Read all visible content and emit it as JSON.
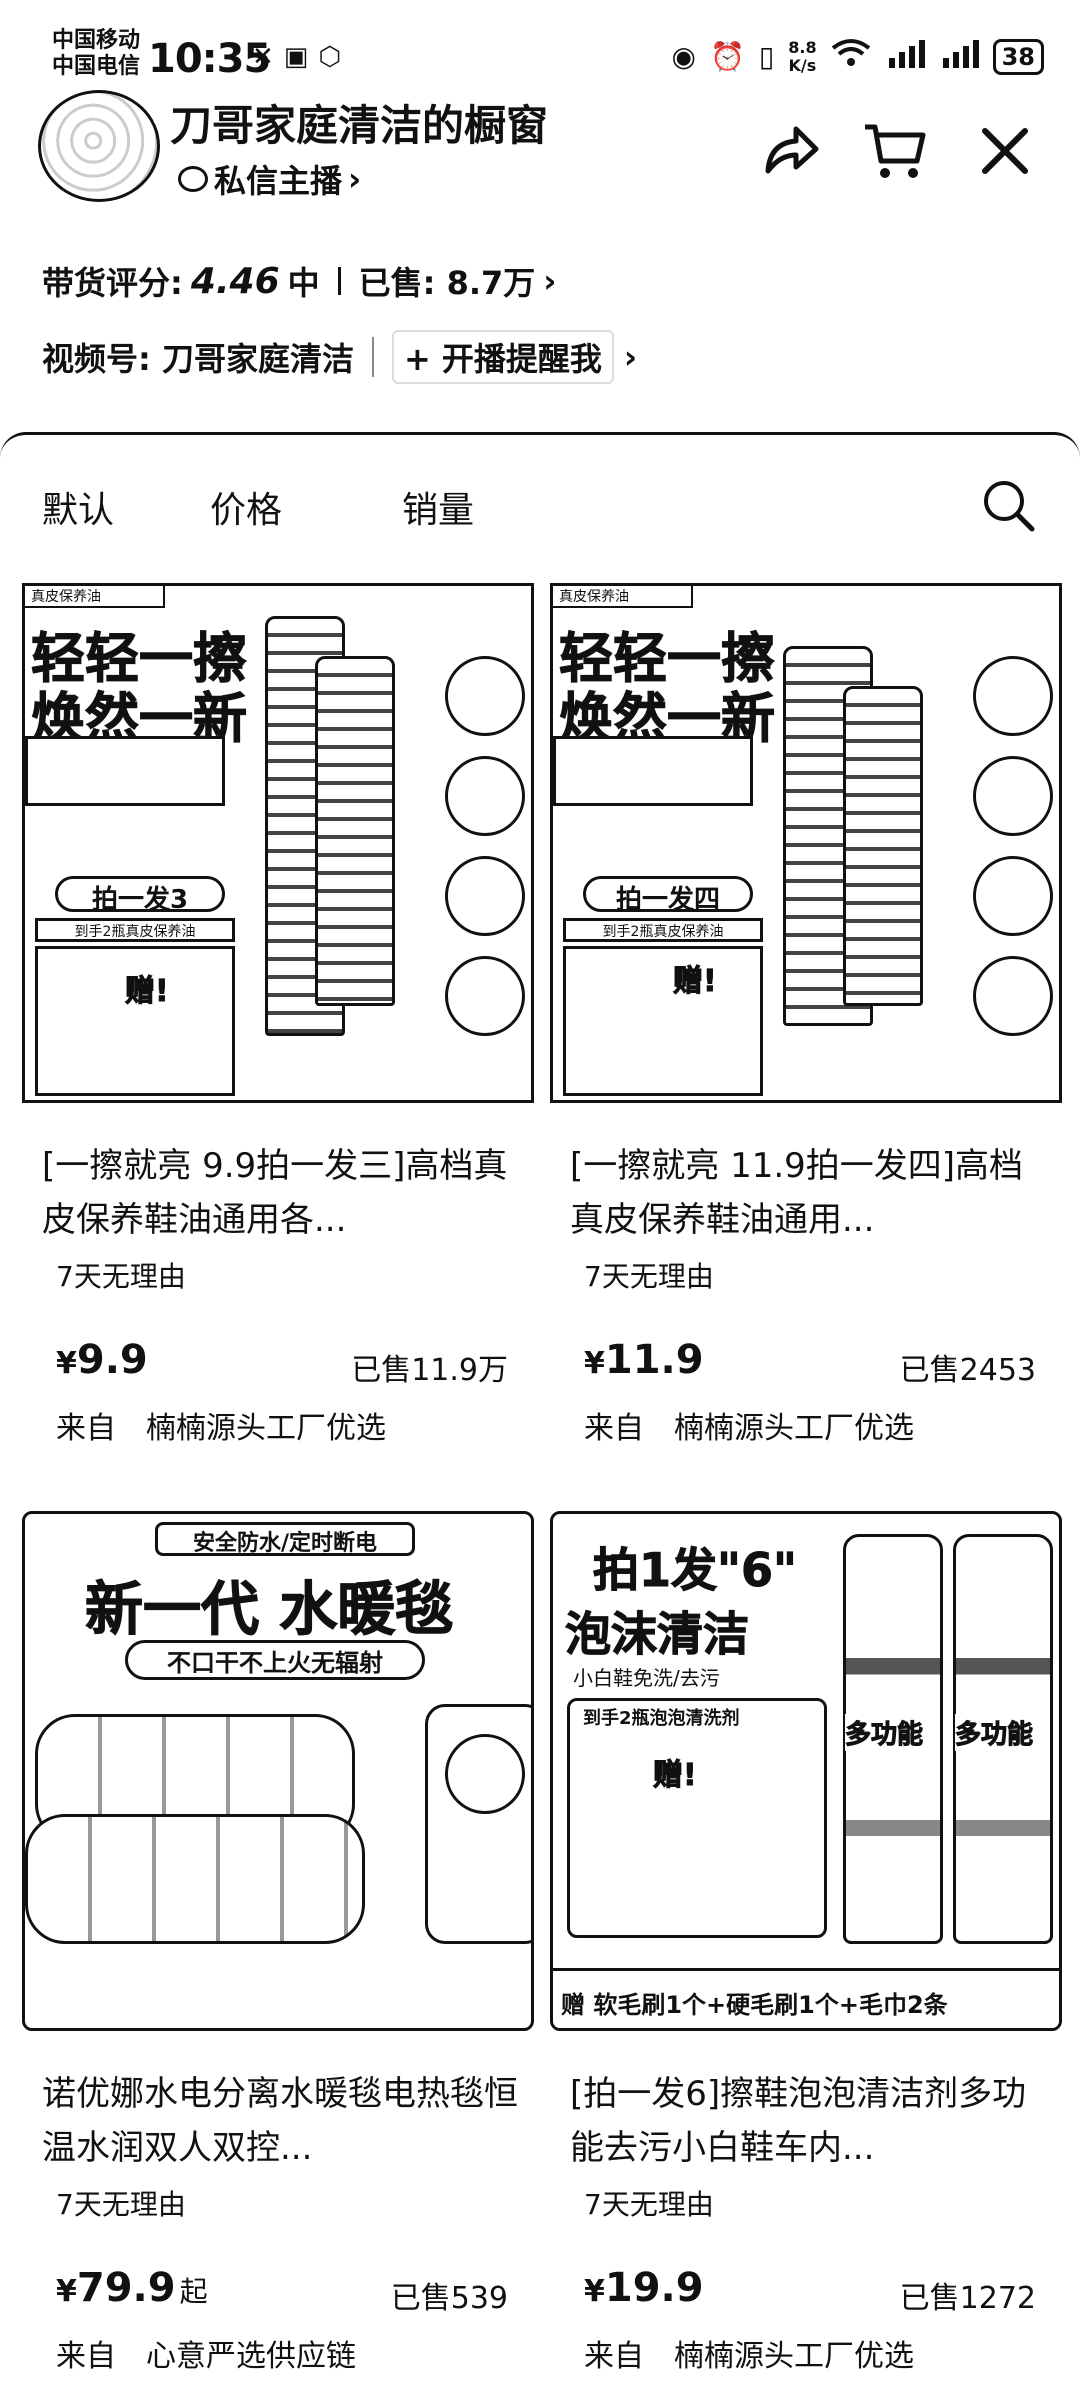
{
  "status_bar": {
    "carrier_1": "中国移动",
    "carrier_2": "中国电信",
    "time": "10:35",
    "net_speed_value": "8.8",
    "net_speed_unit": "K/s",
    "signal_1": "4G",
    "signal_2": "4G",
    "battery": "38"
  },
  "header": {
    "shop_title": "刀哥家庭清洁的橱窗",
    "dm_label": "私信主播",
    "rating_label": "带货评分:",
    "rating_score": "4.46",
    "rating_level": "中",
    "sold_label": "已售: 8.7万",
    "channel_label": "视频号: 刀哥家庭清洁",
    "remind_label": "开播提醒我"
  },
  "tabs": [
    {
      "label": "默认"
    },
    {
      "label": "价格"
    },
    {
      "label": "销量"
    }
  ],
  "products": [
    {
      "name": "[一擦就亮 9.9拍一发三]高档真皮保养鞋油通用各...",
      "tag": "7天无理由",
      "currency": "¥",
      "price": "9.9",
      "price_suffix": "",
      "sold": "已售11.9万",
      "source_label": "来自",
      "source": "楠楠源头工厂优选",
      "art": {
        "line1": "轻轻一擦",
        "line2": "焕然一新",
        "promo": "拍一发3",
        "promo_sub": "到手2瓶真皮保养油",
        "gift": "赠!",
        "badge": "真皮保养油"
      }
    },
    {
      "name": "[一擦就亮 11.9拍一发四]高档真皮保养鞋油通用...",
      "tag": "7天无理由",
      "currency": "¥",
      "price": "11.9",
      "price_suffix": "",
      "sold": "已售2453",
      "source_label": "来自",
      "source": "楠楠源头工厂优选",
      "art": {
        "line1": "轻轻一擦",
        "line2": "焕然一新",
        "promo": "拍一发四",
        "promo_sub": "到手2瓶真皮保养油",
        "gift": "赠!",
        "badge": "真皮保养油"
      }
    },
    {
      "name": "诺优娜水电分离水暖毯电热毯恒温水润双人双控...",
      "tag": "7天无理由",
      "currency": "¥",
      "price": "79.9",
      "price_suffix": "起",
      "sold": "已售539",
      "source_label": "来自",
      "source": "心意严选供应链",
      "art": {
        "line1": "安全防水/定时断电",
        "line2": "新一代 水暖毯",
        "line3": "不口干不上火无辐射"
      }
    },
    {
      "name": "[拍一发6]擦鞋泡泡清洁剂多功能去污小白鞋车内...",
      "tag": "7天无理由",
      "currency": "¥",
      "price": "19.9",
      "price_suffix": "",
      "sold": "已售1272",
      "source_label": "来自",
      "source": "楠楠源头工厂优选",
      "art": {
        "line1": "拍1发\"6\"",
        "line2": "泡沫清洁",
        "line3": "小白鞋免洗/去污",
        "promo_sub": "到手2瓶泡泡清洗剂",
        "gift": "赠!",
        "bottle_label": "多功能",
        "bottom": "赠 软毛刷1个+硬毛刷1个+毛巾2条"
      }
    }
  ]
}
